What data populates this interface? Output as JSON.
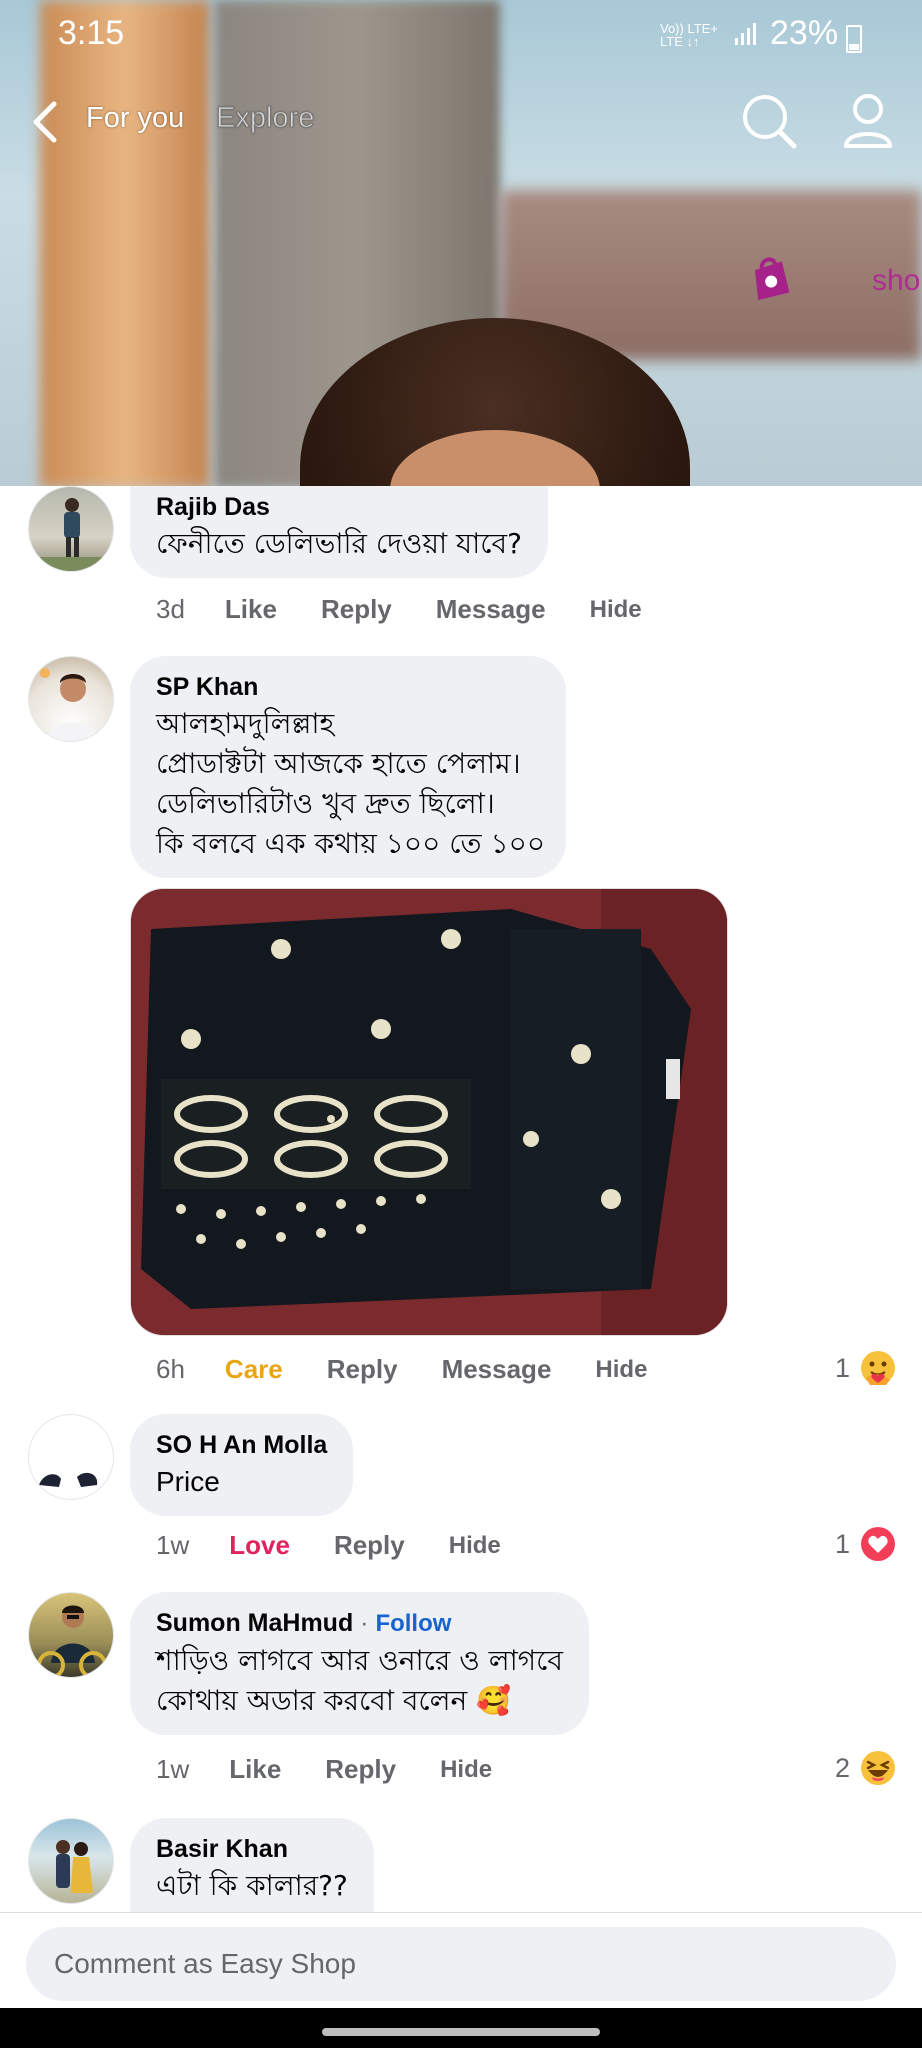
{
  "status_bar": {
    "time": "3:15",
    "network": "Vo)) LTE+\nLTE ↓↑",
    "battery": "23%"
  },
  "top_nav": {
    "tab_for_you": "For you",
    "tab_explore": "Explore"
  },
  "video": {
    "shop_text": "sho"
  },
  "comments": [
    {
      "author": "Rajib Das",
      "text": [
        "ফেনীতে ডেলিভারি দেওয়া  যাবে?"
      ],
      "time": "3d",
      "reaction_label": "Like",
      "reply": "Reply",
      "message": "Message",
      "hide": "Hide"
    },
    {
      "author": "SP Khan",
      "text": [
        "আলহামদুলিল্লাহ",
        "প্রোডাক্টটা আজকে হাতে পেলাম।",
        "ডেলিভারিটাও খুব দ্রুত ছিলো।",
        "কি বলবে এক কথায় ১০০ তে ১০০"
      ],
      "time": "6h",
      "reaction_label": "Care",
      "reply": "Reply",
      "message": "Message",
      "hide": "Hide",
      "reaction_count": "1",
      "reaction_icon": "care-emoji-icon"
    },
    {
      "author": "SO H An Molla",
      "text": [
        "Price"
      ],
      "time": "1w",
      "reaction_label": "Love",
      "reply": "Reply",
      "hide": "Hide",
      "reaction_count": "1",
      "reaction_icon": "love-heart-icon"
    },
    {
      "author": "Sumon MaHmud",
      "follow": "Follow",
      "text": [
        "শাড়িও লাগবে আর ওনারে ও লাগবে",
        "কোথায় অডার করবো বলেন 🥰"
      ],
      "time": "1w",
      "reaction_label": "Like",
      "reply": "Reply",
      "hide": "Hide",
      "reaction_count": "2",
      "reaction_icon": "haha-emoji-icon"
    },
    {
      "author": "Basir Khan",
      "text": [
        "এটা কি কালার??"
      ]
    }
  ],
  "composer": {
    "placeholder": "Comment as Easy Shop"
  },
  "colors": {
    "care": "#e8a616",
    "love": "#e0245e",
    "follow": "#1763cf",
    "bubble": "#eff0f4"
  }
}
